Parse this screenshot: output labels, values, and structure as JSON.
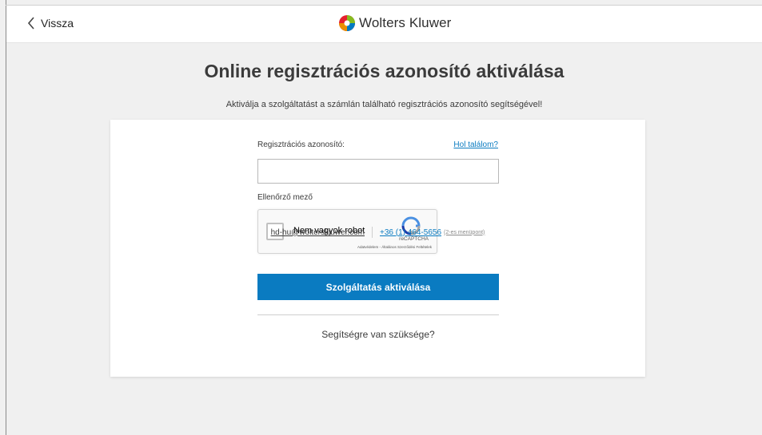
{
  "header": {
    "back_label": "Vissza",
    "brand_name": "Wolters Kluwer"
  },
  "main": {
    "title": "Online regisztrációs azonosító aktiválása",
    "subtitle": "Aktiválja a szolgáltatást a számlán található regisztrációs azonosító segítségével!"
  },
  "form": {
    "code_label": "Regisztrációs azonosító:",
    "help_link": "Hol találom?",
    "code_value": "",
    "captcha_label": "Ellenőrző mező",
    "recaptcha": {
      "checkbox_label": "Nem vagyok robot",
      "brand": "reCAPTCHA",
      "links": "Adatvédelem - Általános Szerződési Feltételek",
      "checked": false
    },
    "submit_label": "Szolgáltatás aktiválása"
  },
  "support": {
    "title": "Segítségre van szüksége?",
    "email": "hd-hu@wolterskluwer.com",
    "phone": "+36 (1) 464-5656",
    "phone_note": "(2-es menüpont)"
  },
  "colors": {
    "accent": "#0a7bc1",
    "background": "#f0f0f0",
    "card": "#ffffff"
  },
  "icons": {
    "back": "chevron-left-icon",
    "brand": "wolters-kluwer-logo",
    "recaptcha": "recaptcha-logo"
  }
}
